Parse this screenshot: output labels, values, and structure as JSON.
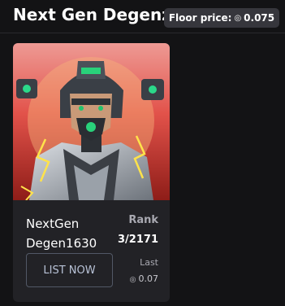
{
  "header": {
    "title": "Next Gen Degenz",
    "floor_label": "Floor price:",
    "floor_value": "0.075",
    "coin_icon": "solana-coin-icon"
  },
  "card": {
    "name": "NextGen Degen1630",
    "rank_label": "Rank",
    "rank_value": "3/2171",
    "list_button_label": "LIST NOW",
    "last_label": "Last",
    "last_value": "0.07"
  },
  "colors": {
    "page_background": "#131315",
    "card_background": "#222226",
    "badge_background": "#36363c",
    "muted_text": "#a9a9b1",
    "button_text": "#b8c2d6"
  }
}
